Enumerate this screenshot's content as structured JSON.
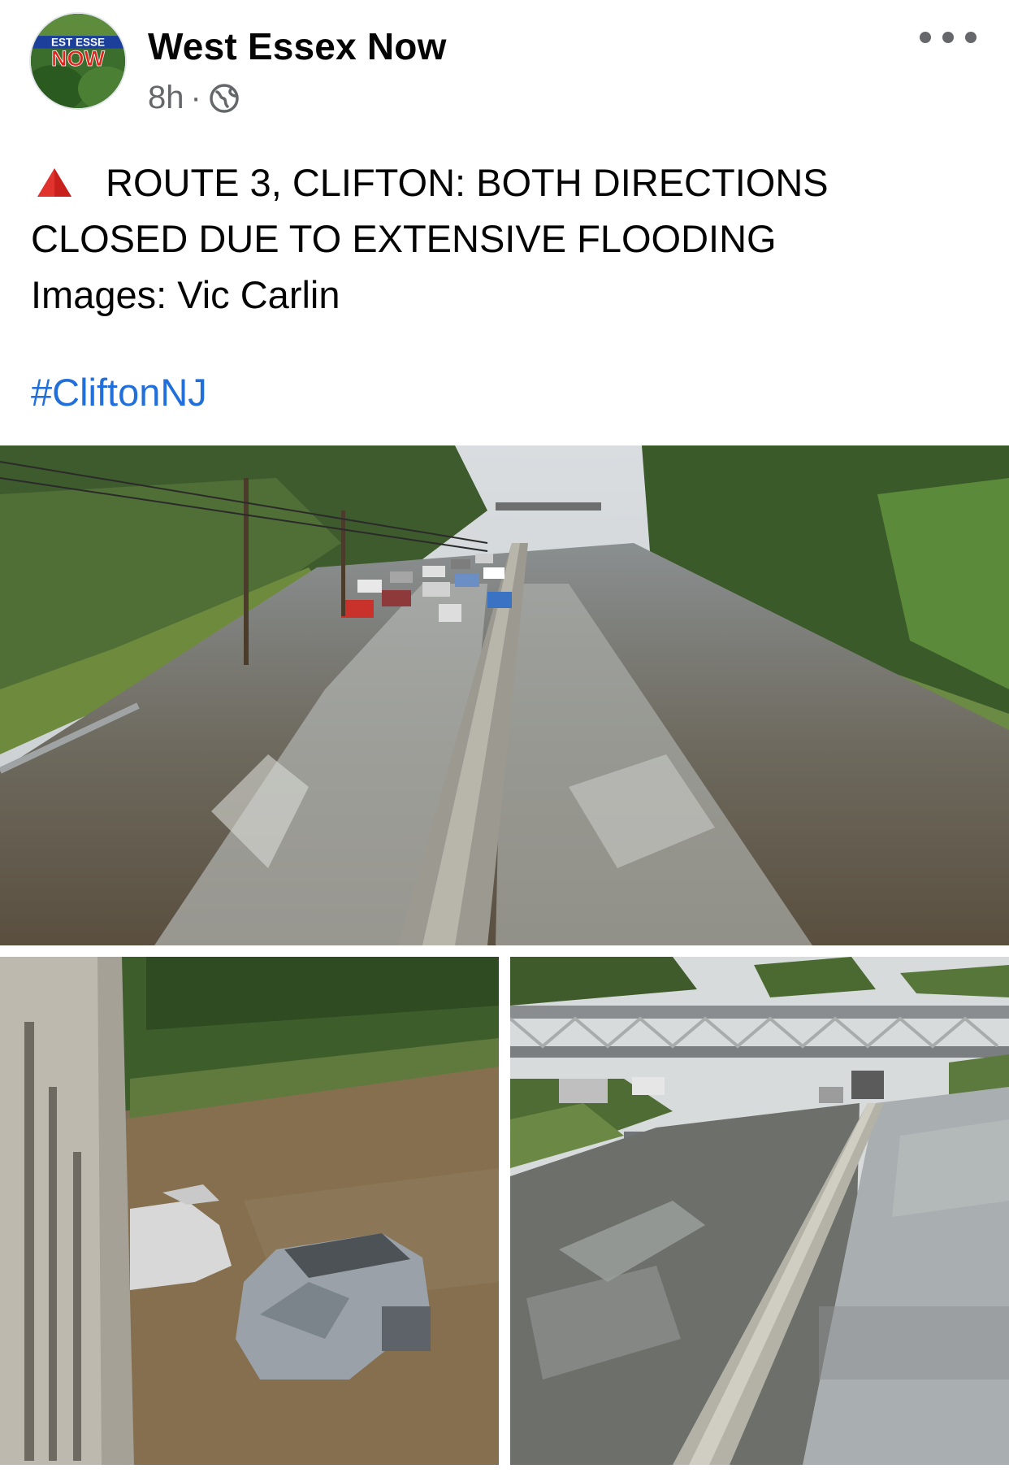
{
  "post": {
    "author": "West Essex Now",
    "avatar": {
      "logo_top": "EST ESSE",
      "logo_bottom": "NOW"
    },
    "time": "8h",
    "separator": "·",
    "privacy_icon": "globe-icon",
    "more_icon": "more-options-icon",
    "alert_icon": "red-triangle-icon",
    "text_lines": [
      "ROUTE 3, CLIFTON: BOTH DIRECTIONS",
      "CLOSED DUE TO EXTENSIVE FLOODING",
      "Images: Vic Carlin"
    ],
    "hashtag": "#CliftonNJ",
    "photos": [
      "flooded-highway-overview",
      "submerged-cars",
      "flooded-highway-footbridge"
    ]
  },
  "colors": {
    "text": "#050505",
    "meta": "#65676b",
    "link": "#216fdb",
    "alert_red": "#e0332e"
  }
}
